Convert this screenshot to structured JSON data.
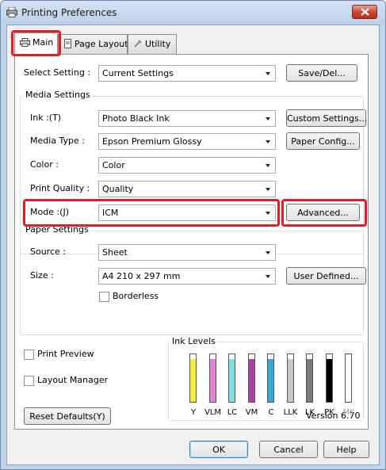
{
  "window": {
    "title": "Printing Preferences"
  },
  "tabs": [
    {
      "label": "Main"
    },
    {
      "label": "Page Layout"
    },
    {
      "label": "Utility"
    }
  ],
  "select_setting": {
    "label": "Select Setting :",
    "value": "Current Settings",
    "button": "Save/Del..."
  },
  "media_settings": {
    "title": "Media Settings",
    "ink_label": "Ink :(T)",
    "ink_value": "Photo Black Ink",
    "custom_button": "Custom Settings...",
    "media_label": "Media Type :",
    "media_value": "Epson Premium Glossy",
    "paper_button": "Paper Config...",
    "color_label": "Color :",
    "color_value": "Color",
    "quality_label": "Print Quality :",
    "quality_value": "Quality",
    "mode_label": "Mode :(J)",
    "mode_value": "ICM",
    "advanced_button": "Advanced..."
  },
  "paper_settings": {
    "title": "Paper Settings",
    "source_label": "Source :",
    "source_value": "Sheet",
    "size_label": "Size :",
    "size_value": "A4 210 x 297 mm",
    "user_button": "User Defined...",
    "borderless_label": "Borderless"
  },
  "options": {
    "print_preview": "Print Preview",
    "layout_manager": "Layout Manager"
  },
  "ink_levels": {
    "title": "Ink Levels",
    "inks": [
      {
        "name": "Y",
        "color": "#f2ee3a",
        "level": 0.9
      },
      {
        "name": "VLM",
        "color": "#e682d6",
        "level": 0.9
      },
      {
        "name": "LC",
        "color": "#7fe0e6",
        "level": 0.9
      },
      {
        "name": "VM",
        "color": "#b23ca6",
        "level": 0.9
      },
      {
        "name": "C",
        "color": "#33a9d8",
        "level": 0.9
      },
      {
        "name": "LLK",
        "color": "#c8c8c8",
        "level": 0.9
      },
      {
        "name": "LK",
        "color": "#7a7a7a",
        "level": 0.9
      },
      {
        "name": "PK",
        "color": "#000000",
        "level": 0.9
      },
      {
        "name": "MK",
        "color": "#ffffff",
        "level": 0.0
      }
    ]
  },
  "footer": {
    "reset": "Reset Defaults(Y)",
    "version": "Version 6.70"
  },
  "dialog": {
    "ok": "OK",
    "cancel": "Cancel",
    "help": "Help"
  },
  "highlight_color": "#e21d24"
}
